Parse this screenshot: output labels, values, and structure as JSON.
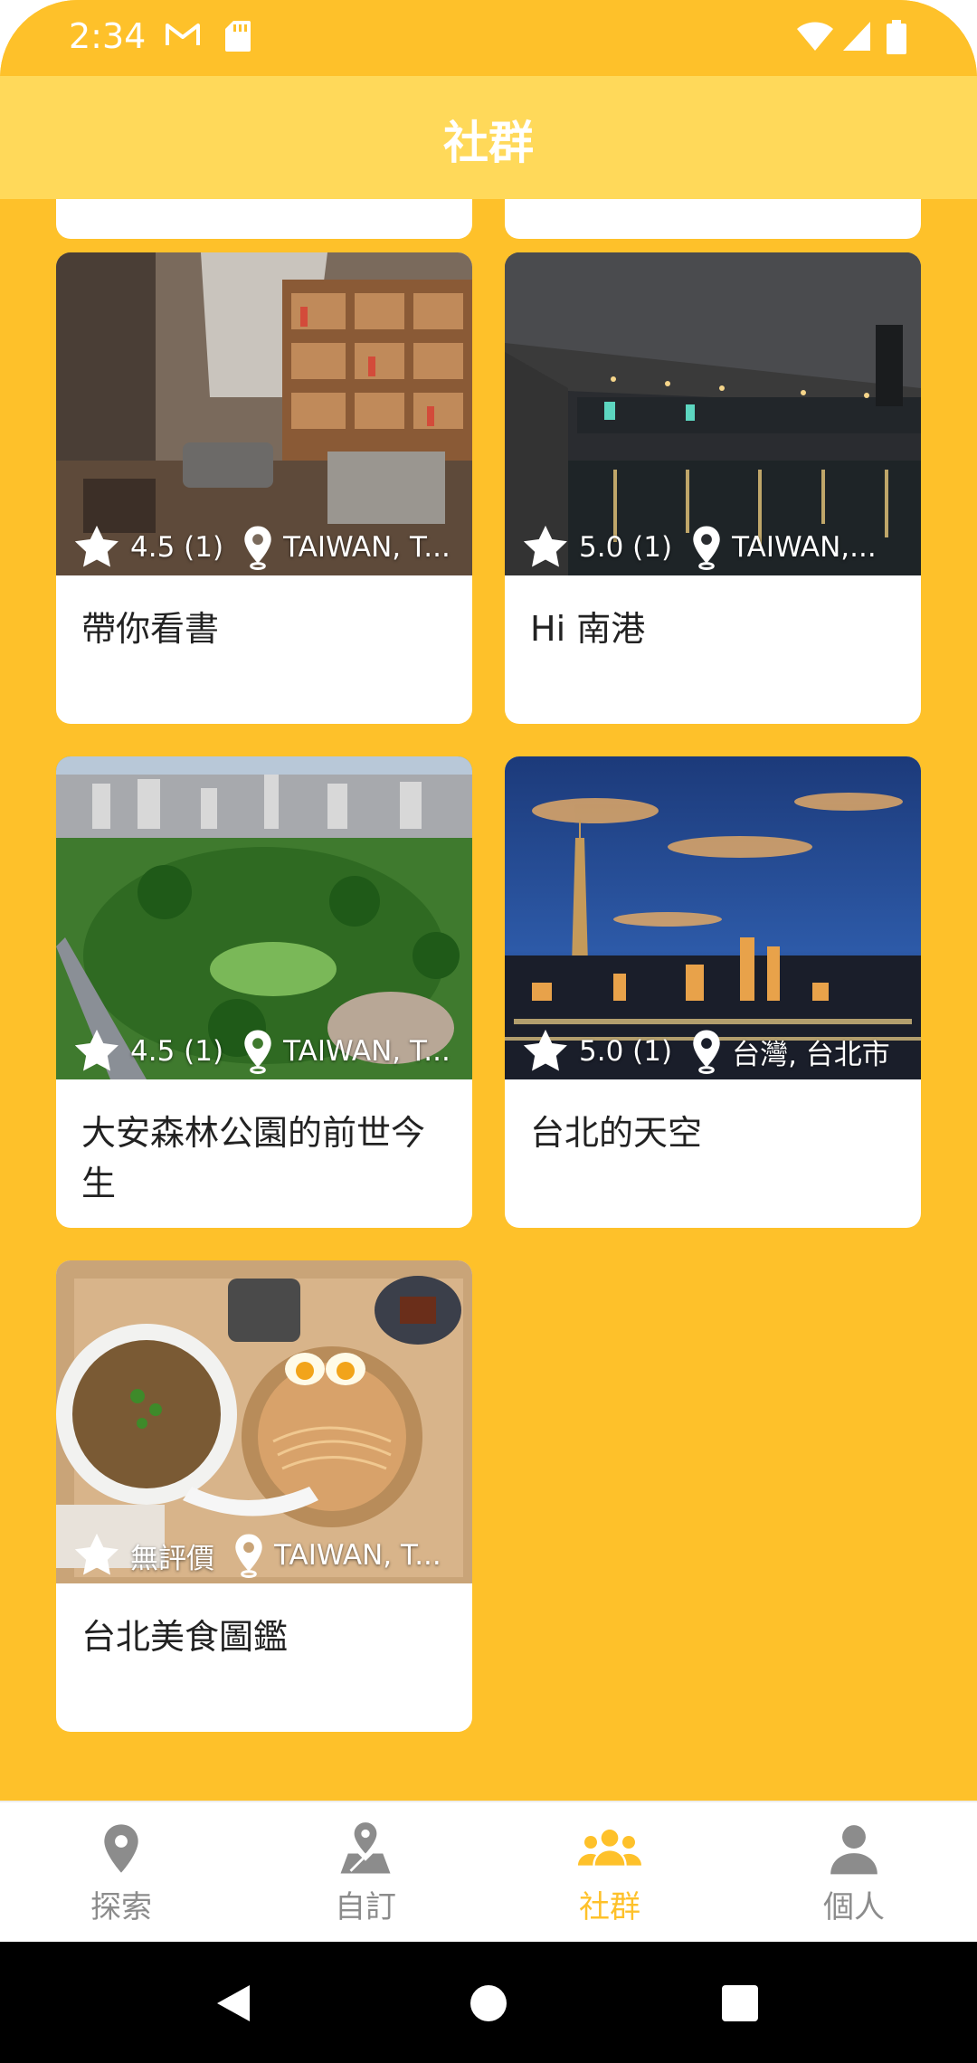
{
  "status_bar": {
    "time": "2:34",
    "icons": [
      "gmail-icon",
      "sd-card-icon",
      "wifi-icon",
      "signal-icon",
      "battery-icon"
    ]
  },
  "app_bar": {
    "title": "社群"
  },
  "colors": {
    "accent": "#FEC12A",
    "app_bar": "#FFD95A",
    "inactive": "#8c8c8c"
  },
  "cards": [
    {
      "title": "帶你看書",
      "rating": "4.5 (1)",
      "location": "TAIWAN, T..."
    },
    {
      "title": "Hi 南港",
      "rating": "5.0 (1)",
      "location": "TAIWAN,..."
    },
    {
      "title": "大安森林公園的前世今生",
      "rating": "4.5 (1)",
      "location": "TAIWAN, T..."
    },
    {
      "title": "台北的天空",
      "rating": "5.0 (1)",
      "location": "台灣, 台北市"
    },
    {
      "title": "台北美食圖鑑",
      "rating": "無評價",
      "location": "TAIWAN, T..."
    }
  ],
  "bottom_nav": [
    {
      "label": "探索",
      "icon": "map-pin-icon",
      "active": false
    },
    {
      "label": "自訂",
      "icon": "map-icon",
      "active": false
    },
    {
      "label": "社群",
      "icon": "group-icon",
      "active": true
    },
    {
      "label": "個人",
      "icon": "person-icon",
      "active": false
    }
  ],
  "system_nav": [
    "back-icon",
    "home-icon",
    "recents-icon"
  ]
}
